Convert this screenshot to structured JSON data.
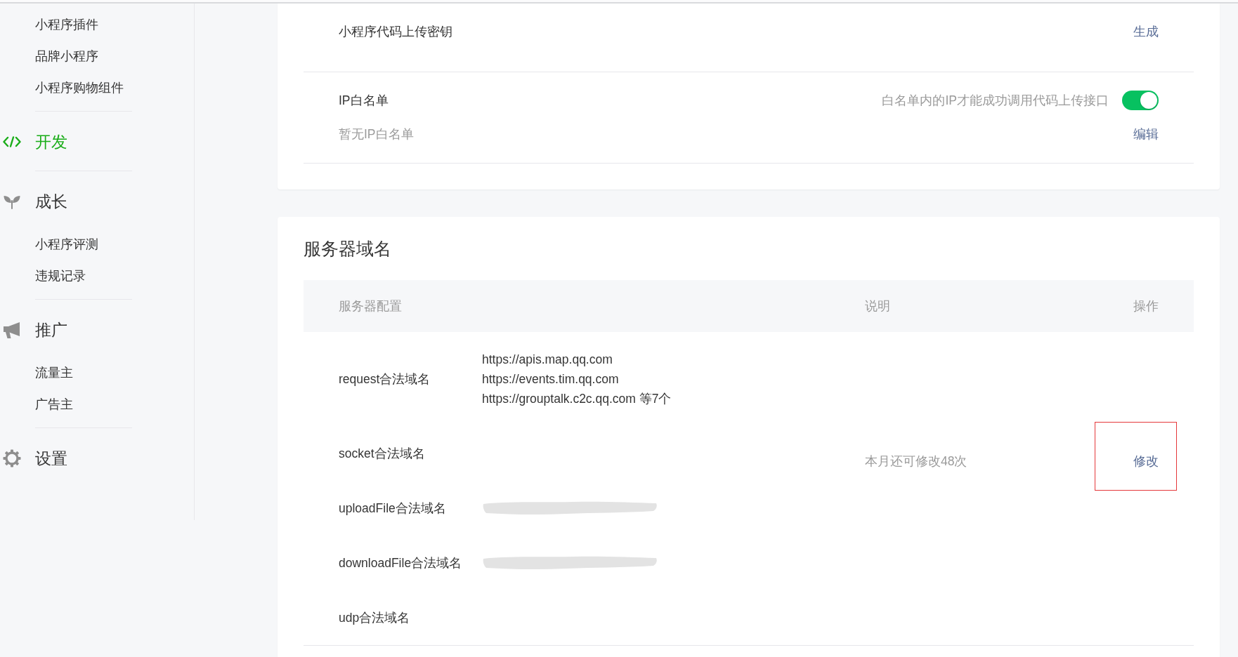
{
  "sidebar": {
    "sections": [
      {
        "items": [
          {
            "label": "小程序插件",
            "selected": false
          },
          {
            "label": "品牌小程序",
            "selected": false
          },
          {
            "label": "小程序购物组件",
            "selected": false
          }
        ]
      },
      {
        "title": "开发",
        "selected": true
      },
      {
        "title": "成长",
        "selected": false,
        "items": [
          {
            "label": "小程序评测",
            "selected": false
          },
          {
            "label": "违规记录",
            "selected": false
          }
        ]
      },
      {
        "title": "推广",
        "selected": false,
        "items": [
          {
            "label": "流量主",
            "selected": false
          },
          {
            "label": "广告主",
            "selected": false
          }
        ]
      },
      {
        "title": "设置",
        "selected": false
      }
    ]
  },
  "upload_key_card": {
    "rows": [
      {
        "label": "小程序代码上传密钥",
        "action": "生成"
      },
      {
        "label": "IP白名单",
        "hint": "白名单内的IP才能成功调用代码上传接口",
        "toggle": {
          "on": true
        },
        "status": "暂无IP白名单",
        "action": "编辑"
      }
    ]
  },
  "server_domains": {
    "title": "服务器域名",
    "columns": [
      "服务器配置",
      "说明",
      "操作"
    ],
    "rows": [
      {
        "name": "request合法域名",
        "redacted": false,
        "values": [
          "https://apis.map.qq.com",
          "https://events.tim.qq.com",
          "https://grouptalk.c2c.qq.com 等7个"
        ]
      },
      {
        "name": "socket合法域名",
        "redacted": false
      },
      {
        "name": "uploadFile合法域名",
        "redacted": true
      },
      {
        "name": "downloadFile合法域名",
        "redacted": true
      },
      {
        "name": "udp合法域名",
        "redacted": false
      }
    ],
    "note": "本月还可修改48次",
    "action": {
      "label": "修改",
      "highlighted": true
    }
  }
}
